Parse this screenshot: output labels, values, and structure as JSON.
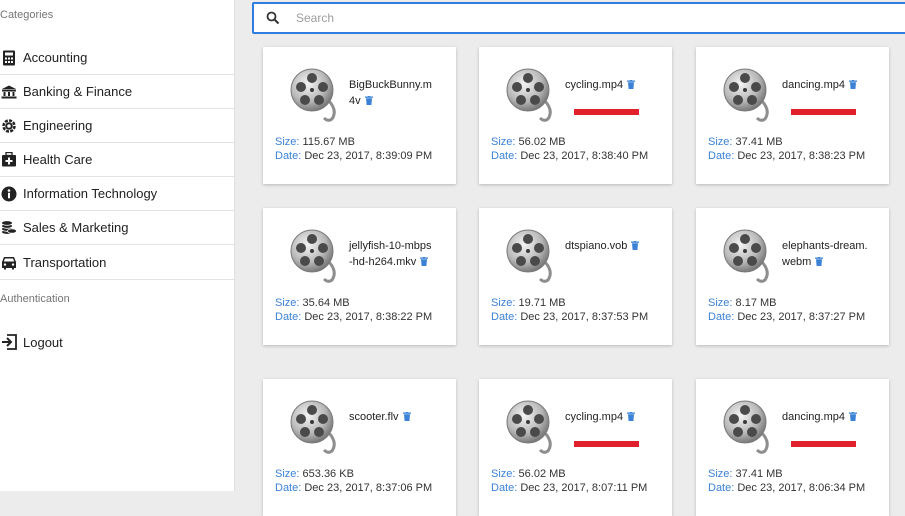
{
  "sidebar": {
    "categories_title": "Categories",
    "items": [
      {
        "label": "Accounting",
        "icon": "calculator-icon"
      },
      {
        "label": "Banking & Finance",
        "icon": "bank-icon"
      },
      {
        "label": "Engineering",
        "icon": "gear-icon"
      },
      {
        "label": "Health Care",
        "icon": "medical-kit-icon"
      },
      {
        "label": "Information Technology",
        "icon": "info-icon"
      },
      {
        "label": "Sales & Marketing",
        "icon": "coins-icon"
      },
      {
        "label": "Transportation",
        "icon": "car-icon"
      }
    ],
    "auth_title": "Authentication",
    "logout_label": "Logout"
  },
  "search": {
    "placeholder": "Search"
  },
  "files": [
    {
      "name": "BigBuckBunny.m4v",
      "size": "115.67 MB",
      "date": "Dec 23, 2017, 8:39:09 PM",
      "progress": null
    },
    {
      "name": "cycling.mp4",
      "size": "56.02 MB",
      "date": "Dec 23, 2017, 8:38:40 PM",
      "progress": 1.0
    },
    {
      "name": "dancing.mp4",
      "size": "37.41 MB",
      "date": "Dec 23, 2017, 8:38:23 PM",
      "progress": 1.0
    },
    {
      "name": "jellyfish-10-mbps-hd-h264.mkv",
      "size": "35.64 MB",
      "date": "Dec 23, 2017, 8:38:22 PM",
      "progress": null
    },
    {
      "name": "dtspiano.vob",
      "size": "19.71 MB",
      "date": "Dec 23, 2017, 8:37:53 PM",
      "progress": null
    },
    {
      "name": "elephants-dream.webm",
      "size": "8.17 MB",
      "date": "Dec 23, 2017, 8:37:27 PM",
      "progress": null
    },
    {
      "name": "scooter.flv",
      "size": "653.36 KB",
      "date": "Dec 23, 2017, 8:37:06 PM",
      "progress": null
    },
    {
      "name": "cycling.mp4",
      "size": "56.02 MB",
      "date": "Dec 23, 2017, 8:07:11 PM",
      "progress": 1.0
    },
    {
      "name": "dancing.mp4",
      "size": "37.41 MB",
      "date": "Dec 23, 2017, 8:06:34 PM",
      "progress": 1.0
    }
  ],
  "labels": {
    "size": "Size:",
    "date": "Date:"
  },
  "colors": {
    "accent": "#2f7de1",
    "progress": "#e0202b",
    "key_text": "#3b82d6"
  }
}
